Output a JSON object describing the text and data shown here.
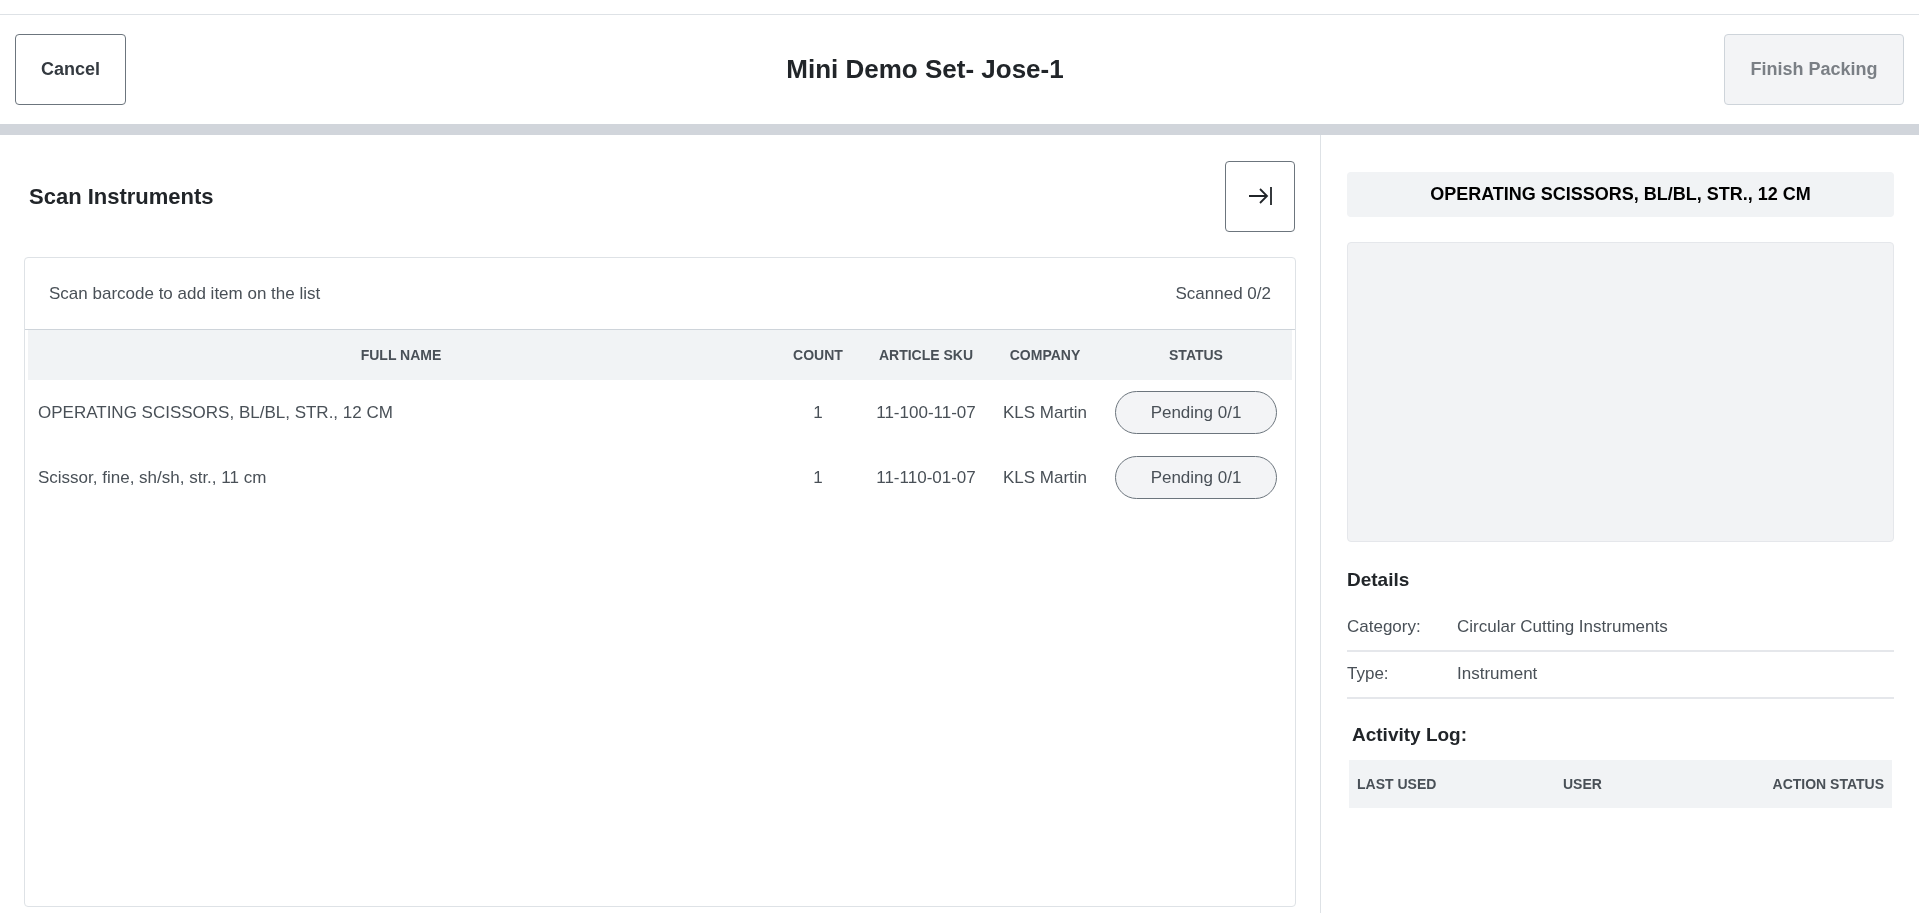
{
  "header": {
    "cancel_button": "Cancel",
    "title": "Mini Demo Set- Jose-1",
    "finish_button": {
      "label": "Finish Packing",
      "disabled": true
    }
  },
  "scan_panel": {
    "title": "Scan Instruments",
    "hint": "Scan barcode to add item on the list",
    "scanned": "Scanned 0/2",
    "table": {
      "columns": [
        "FULL NAME",
        "COUNT",
        "ARTICLE SKU",
        "COMPANY",
        "STATUS"
      ],
      "rows": [
        {
          "full_name": "OPERATING SCISSORS, BL/BL, STR., 12 CM",
          "count": "1",
          "article_sku": "11-100-11-07",
          "company": "KLS Martin",
          "status": "Pending 0/1"
        },
        {
          "full_name": "Scissor, fine, sh/sh, str., 11 cm",
          "count": "1",
          "article_sku": "11-110-01-07",
          "company": "KLS Martin",
          "status": "Pending 0/1"
        }
      ]
    }
  },
  "detail_panel": {
    "title": "OPERATING SCISSORS, BL/BL, STR., 12 CM",
    "details_heading": "Details",
    "details": [
      {
        "label": "Category:",
        "value": "Circular Cutting Instruments"
      },
      {
        "label": "Type:",
        "value": "Instrument"
      }
    ],
    "activity_heading": "Activity Log:",
    "activity_columns": [
      "LAST USED",
      "USER",
      "ACTION STATUS"
    ]
  }
}
